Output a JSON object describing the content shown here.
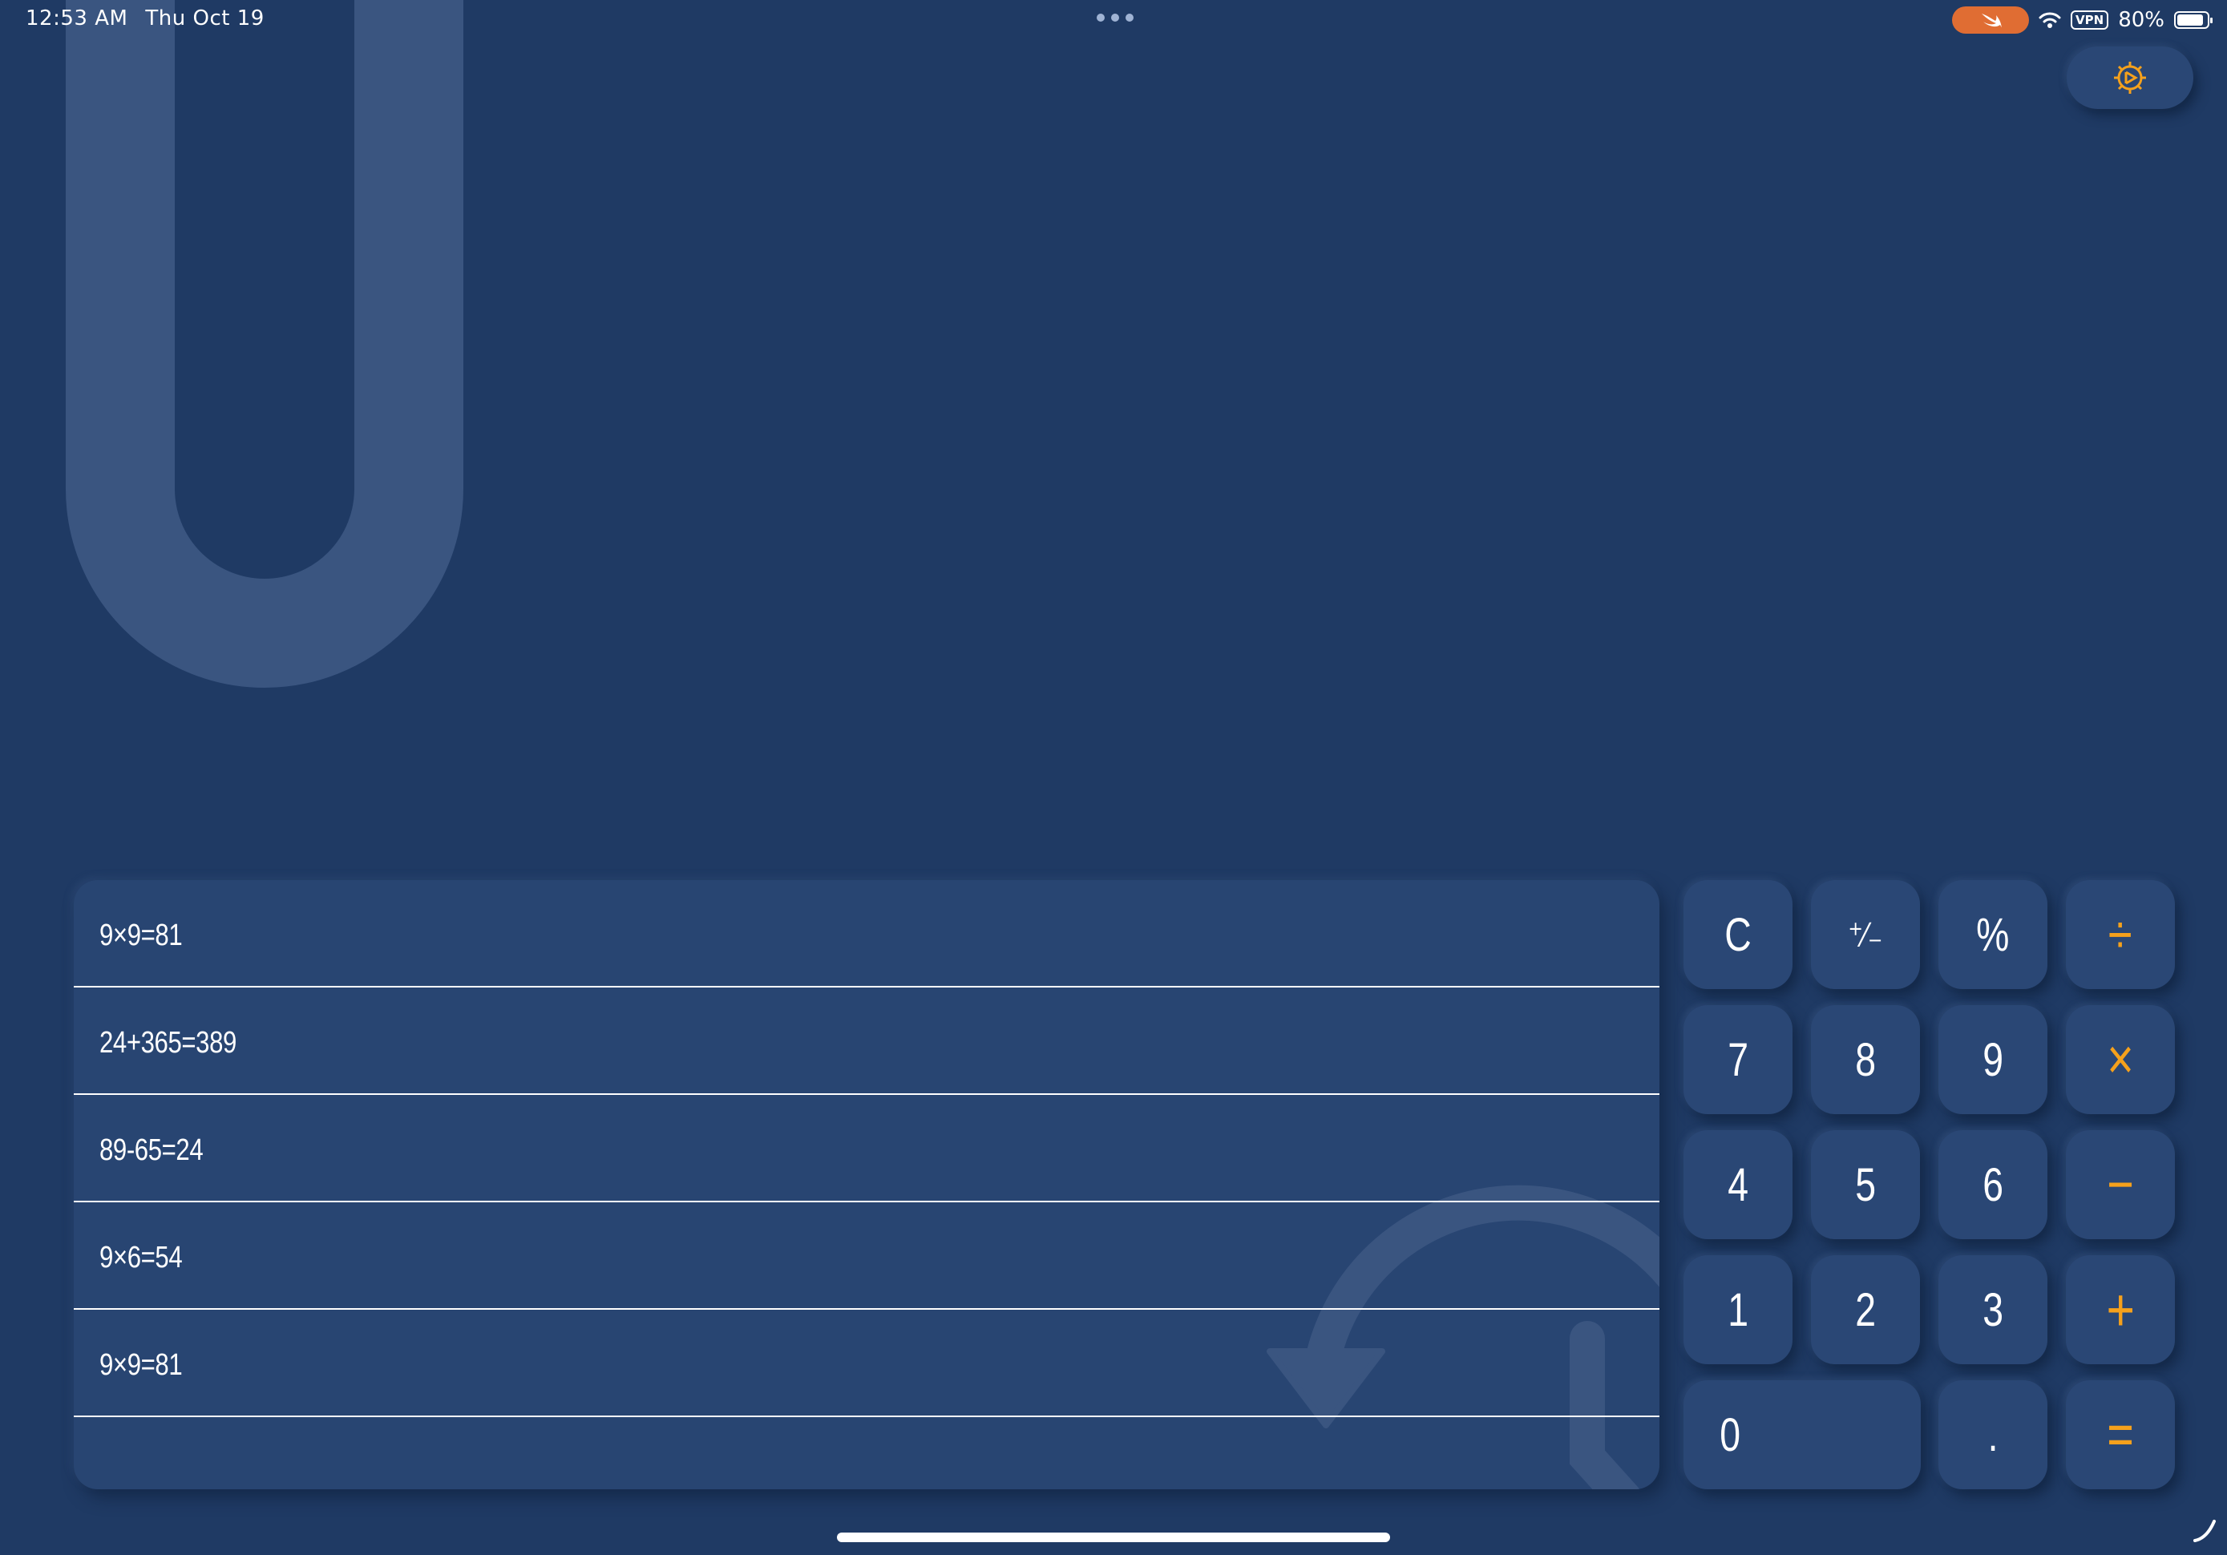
{
  "status_bar": {
    "time": "12:53 AM",
    "date": "Thu Oct 19",
    "vpn_label": "VPN",
    "battery_percent": "80%",
    "battery_level": 0.8
  },
  "app": {
    "background_color": "#1f3a64",
    "accent_color": "#f5a11c",
    "settings_icon": "gear-icon"
  },
  "history": {
    "entries": [
      "9×9=81",
      "24+365=389",
      "89-65=24",
      "9×6=54",
      "9×9=81"
    ],
    "decor_icon": "history-clock-icon"
  },
  "keypad": {
    "row1": [
      "C",
      "⁺∕₋",
      "%",
      "÷"
    ],
    "row2": [
      "7",
      "8",
      "9",
      "×"
    ],
    "row3": [
      "4",
      "5",
      "6",
      "−"
    ],
    "row4": [
      "1",
      "2",
      "3",
      "+"
    ],
    "row5": [
      "0",
      ".",
      "="
    ]
  }
}
